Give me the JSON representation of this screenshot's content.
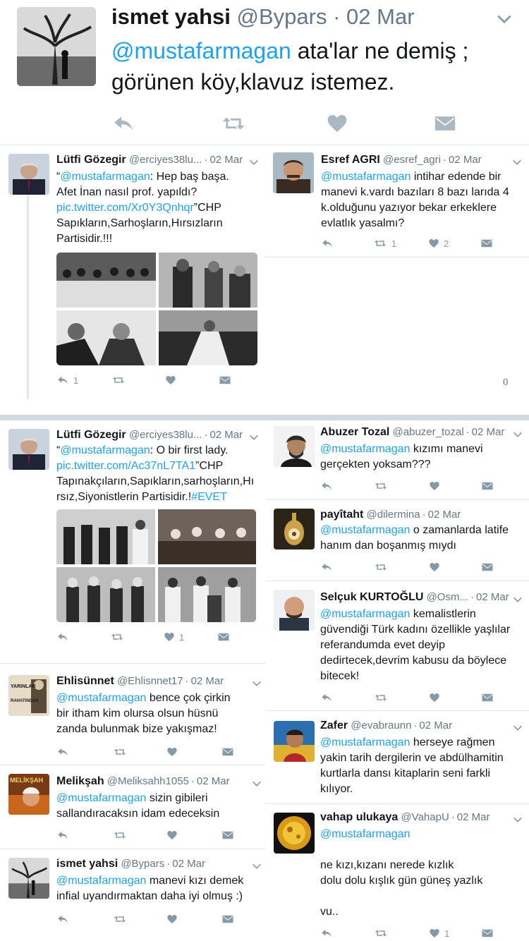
{
  "main": {
    "name": "ismet yahsi",
    "handle": "@Bypars",
    "date": "02 Mar",
    "mention": "@mustafarmagan",
    "text1": " ata'lar ne demiş ;",
    "text2": "görünen köy,klavuz istemez."
  },
  "left1": {
    "name": "Lütfi  Gözegir",
    "handle": "@erciyes38lu...",
    "date": "02 Mar",
    "quote_open": "“",
    "mention": "@mustafarmagan",
    "text_a": ": Hep baş başa.",
    "text_b": "Afet İnan nasıl prof. yapıldı?",
    "link": "pic.twitter.com/Xr0Y3Qnhqr",
    "text_c": "”CHP",
    "text_d": "Sapıkların,Sarhoşların,Hırsızların",
    "text_e": "Partisidir.!!!",
    "reply_count": "1"
  },
  "right1": {
    "name": "Esref AGRI",
    "handle": "@esref_agri",
    "date": "02 Mar",
    "mention": "@mustafarmagan",
    "text_a": " intihar edende bir",
    "text_b": "manevi k.vardı bazıları 8 bazı larıda 4",
    "text_c": "k.olduğunu yazıyor bekar erkeklere",
    "text_d": "evlatlık yasalmı?",
    "retweet_count": "1",
    "like_count": "2",
    "zero": "0"
  },
  "left2": {
    "name": "Lütfi  Gözegir",
    "handle": "@erciyes38lu...",
    "date": "02 Mar",
    "quote_open": "“",
    "mention": "@mustafarmagan",
    "text_a": ": O bir first lady.",
    "link": "pic.twitter.com/Ac37nL7TA1",
    "text_b": "”CHP",
    "text_c": "Tapınakçıların,Sapıkların,sarhoşların,Hı",
    "text_d": "rsız,Siyonistlerin Partisidir.!",
    "hashtag": "#EVET",
    "like_count": "1"
  },
  "left3": {
    "name": "Ehlisünnet",
    "handle": "@Ehlisnnet17",
    "date": "02 Mar",
    "mention": "@mustafarmagan",
    "text_a": "  bence çok çirkin",
    "text_b": "bir itham kim olursa olsun hüsnü",
    "text_c": "zanda bulunmak bize yakışmaz!",
    "avatar_text1": "YARINLAR",
    "avatar_text2": "RAHATINDAN"
  },
  "left4": {
    "name": "Melikşah",
    "handle": "@Meliksahh1055",
    "date": "02 Mar",
    "mention": "@mustafarmagan",
    "text_a": " sizin gibileri",
    "text_b": "sallandıracaksın idam edeceksin",
    "avatar_text": "MELİKŞAH"
  },
  "left5": {
    "name": "ismet yahsi",
    "handle": "@Bypars",
    "date": "02 Mar",
    "mention": "@mustafarmagan",
    "text_a": " manevi kızı demek",
    "text_b": "infial uyandırmaktan daha iyi olmuş :)"
  },
  "right2": {
    "name": "Abuzer Tozal",
    "handle": "@abuzer_tozal",
    "date": "02 Mar",
    "mention": "@mustafarmagan",
    "text_a": " kızımı manevi",
    "text_b": "gerçekten yoksam???"
  },
  "right3": {
    "name": "payîtaht",
    "handle": "@dilermina",
    "date": "02 Mar",
    "mention": "@mustafarmagan",
    "text_a": " o zamanlarda latife",
    "text_b": "hanım dan boşanmış mıydı"
  },
  "right4": {
    "name": "Selçuk KURTOĞLU",
    "handle": "@Osm...",
    "date": "02 Mar",
    "mention": "@mustafarmagan",
    "text_a": " kemalistlerin",
    "text_b": "güvendiği Türk kadını özellikle yaşlılar",
    "text_c": "referandumda evet deyip",
    "text_d": "dedirtecek,devrim kabusu da böylece",
    "text_e": "bitecek!"
  },
  "right5": {
    "name": "Zafer",
    "handle": "@evabraunn",
    "date": "02 Mar",
    "mention": "@mustafarmagan",
    "text_a": " herseye rağmen",
    "text_b": "yakin tarih dergilerin ve abdülhamitin",
    "text_c": "kurtlarla dansı kitaplarin seni farkli",
    "text_d": "kılıyor."
  },
  "right6": {
    "name": "vahap ulukaya",
    "handle": "@VahapU",
    "date": "02 Mar",
    "mention": "@mustafarmagan",
    "text_a": "ne kızı,kızanı nerede kızlık",
    "text_b": "dolu dolu kışlık gün güneş yazlık",
    "text_c": "vu..",
    "like_count": "1"
  },
  "colors": {
    "link": "#1da1f2",
    "icon": "#aab8c2",
    "text": "#14171a",
    "muted": "#657786"
  }
}
